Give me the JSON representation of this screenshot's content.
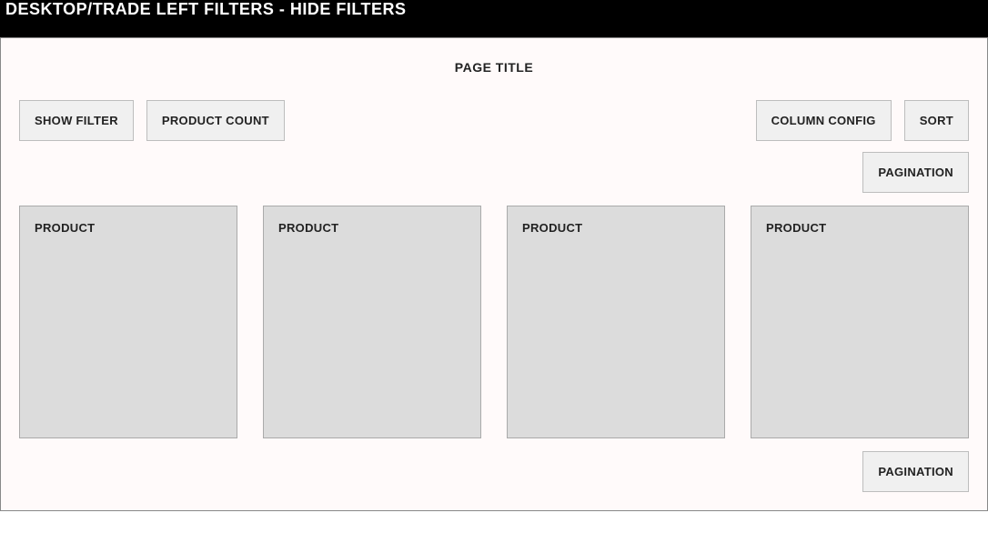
{
  "header": {
    "title": "DESKTOP/TRADE LEFT FILTERS - HIDE FILTERS"
  },
  "page": {
    "title": "PAGE TITLE"
  },
  "toolbar": {
    "show_filter": "SHOW FILTER",
    "product_count": "PRODUCT COUNT",
    "column_config": "COLUMN CONFIG",
    "sort": "SORT"
  },
  "pagination": {
    "top": "PAGINATION",
    "bottom": "PAGINATION"
  },
  "products": [
    {
      "label": "PRODUCT"
    },
    {
      "label": "PRODUCT"
    },
    {
      "label": "PRODUCT"
    },
    {
      "label": "PRODUCT"
    }
  ]
}
